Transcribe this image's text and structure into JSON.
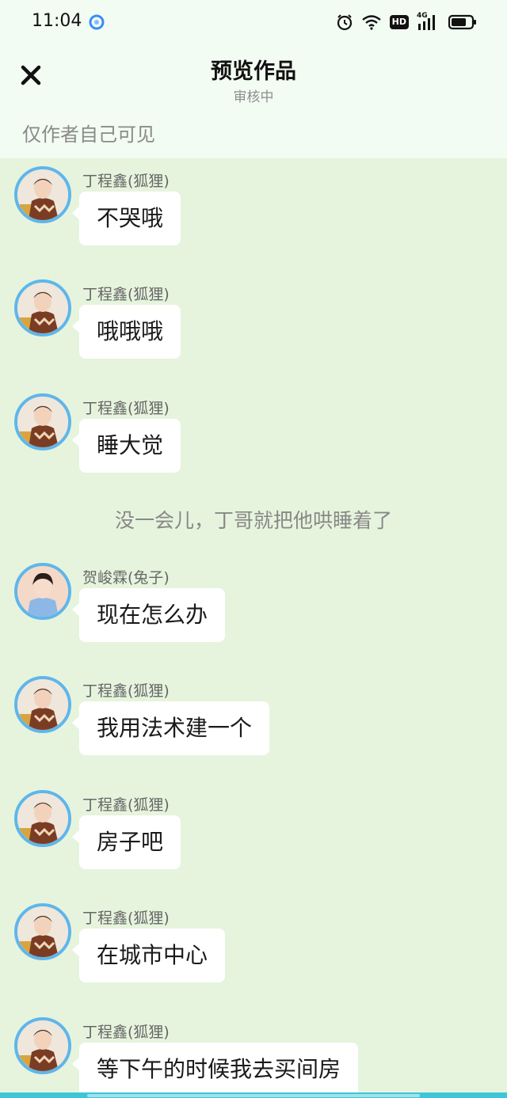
{
  "status_bar": {
    "time": "11:04",
    "hd": "HD",
    "network": "4G",
    "icons": [
      "app-logo-icon",
      "alarm-icon",
      "wifi-icon",
      "hd-icon",
      "signal-icon",
      "battery-icon"
    ]
  },
  "header": {
    "title": "预览作品",
    "subtitle": "审核中",
    "close_icon": "close-icon"
  },
  "visibility_note": "仅作者自己可见",
  "colors": {
    "background": "#e6f4dd",
    "header_background": "#f2fcf3",
    "avatar_ring": "#5fb6ea",
    "bubble": "#ffffff",
    "bottom_bar": "#3ec6d8"
  },
  "messages": [
    {
      "sender": "丁程鑫(狐狸)",
      "text": "不哭哦"
    },
    {
      "sender": "丁程鑫(狐狸)",
      "text": "哦哦哦"
    },
    {
      "sender": "丁程鑫(狐狸)",
      "text": "睡大觉"
    },
    {
      "sender": "贺峻霖(兔子)",
      "text": "现在怎么办"
    },
    {
      "sender": "丁程鑫(狐狸)",
      "text": "我用法术建一个"
    },
    {
      "sender": "丁程鑫(狐狸)",
      "text": "房子吧"
    },
    {
      "sender": "丁程鑫(狐狸)",
      "text": "在城市中心"
    },
    {
      "sender": "丁程鑫(狐狸)",
      "text": "等下午的时候我去买间房"
    }
  ],
  "narration": "没一会儿，丁哥就把他哄睡着了"
}
